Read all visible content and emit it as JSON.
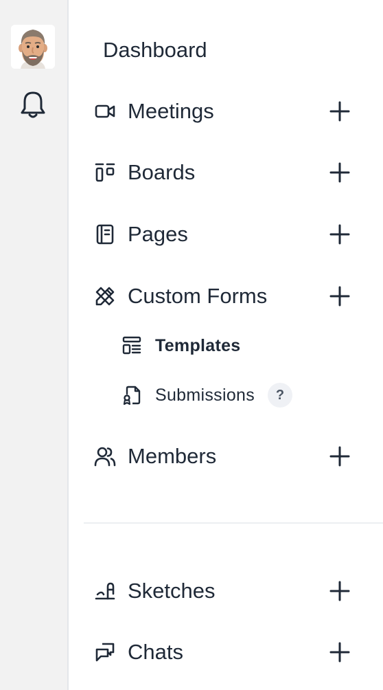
{
  "rail": {
    "avatar_icon": "user-avatar",
    "bell_icon": "bell-icon"
  },
  "menu": {
    "dashboard": "Dashboard",
    "items_top": [
      {
        "label": "Meetings",
        "icon": "video-icon"
      },
      {
        "label": "Boards",
        "icon": "boards-icon"
      },
      {
        "label": "Pages",
        "icon": "notebook-icon"
      },
      {
        "label": "Custom Forms",
        "icon": "pencil-ruler-icon"
      }
    ],
    "sub_items": [
      {
        "label": "Templates",
        "icon": "template-icon",
        "active": true
      },
      {
        "label": "Submissions",
        "icon": "file-signature-icon",
        "help": "?"
      }
    ],
    "members": {
      "label": "Members",
      "icon": "users-icon"
    },
    "items_bottom": [
      {
        "label": "Sketches",
        "icon": "sketch-icon"
      },
      {
        "label": "Chats",
        "icon": "chats-icon"
      }
    ],
    "add_icon": "plus-icon"
  },
  "colors": {
    "rail_bg": "#f2f2f2",
    "text": "#1f2937",
    "divider": "#eceef1",
    "help_bg": "#eff1f5"
  }
}
